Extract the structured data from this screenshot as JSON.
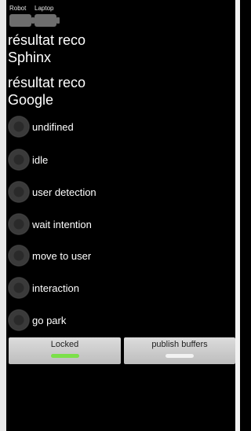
{
  "battery": {
    "robot_label": "Robot",
    "laptop_label": "Laptop"
  },
  "recognition": {
    "sphinx_line1": "résultat reco",
    "sphinx_line2": "Sphinx",
    "google_line1": "résultat reco",
    "google_line2": "Google"
  },
  "states": [
    {
      "label": "undifined"
    },
    {
      "label": "idle"
    },
    {
      "label": "user detection"
    },
    {
      "label": "wait intention"
    },
    {
      "label": "move to user"
    },
    {
      "label": "interaction"
    },
    {
      "label": "go park"
    }
  ],
  "buttons": {
    "locked_label": "Locked",
    "locked_indicator_color": "#7be04a",
    "publish_label": "publish buffers",
    "publish_indicator_color": "#f2f2f2"
  },
  "colors": {
    "background": "#000000",
    "text": "#ffffff",
    "button_bg": "#c9c9c9"
  }
}
